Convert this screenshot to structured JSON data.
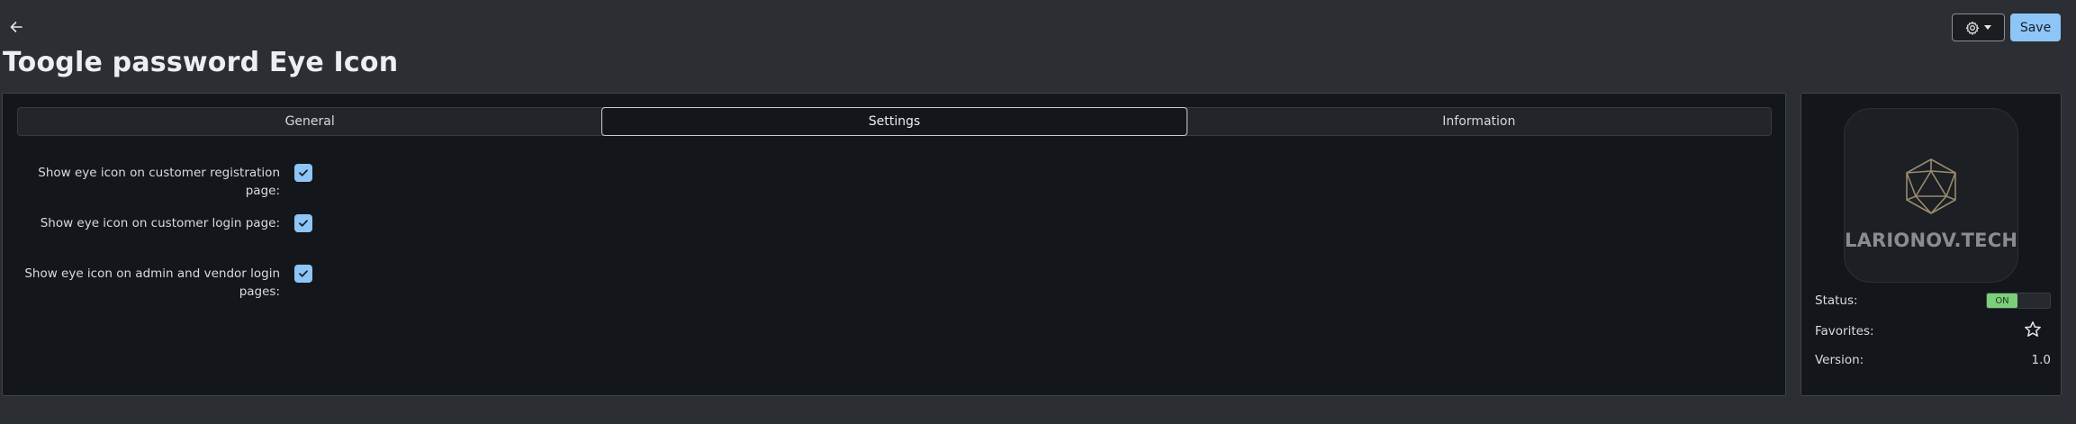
{
  "header": {
    "back_icon": "arrow-left-icon",
    "title": "Toogle password Eye Icon",
    "settings_icon": "gear-icon",
    "save_label": "Save"
  },
  "tabs": [
    {
      "label": "General",
      "active": false
    },
    {
      "label": "Settings",
      "active": true
    },
    {
      "label": "Information",
      "active": false
    }
  ],
  "settings": [
    {
      "label": "Show eye icon on customer registration page:",
      "checked": true
    },
    {
      "label": "Show eye icon on customer login page:",
      "checked": true
    },
    {
      "label": "Show eye icon on admin and vendor login pages:",
      "checked": true
    }
  ],
  "addon": {
    "logo_text": "LARIONOV.TECH",
    "status_label": "Status:",
    "status_value": "ON",
    "favorites_label": "Favorites:",
    "favorites_icon": "star-icon",
    "version_label": "Version:",
    "version_value": "1.0"
  },
  "colors": {
    "accent": "#8ec5f7",
    "toggle_on": "#7cd07a",
    "background": "#2b2e33",
    "panel": "#13161a"
  }
}
